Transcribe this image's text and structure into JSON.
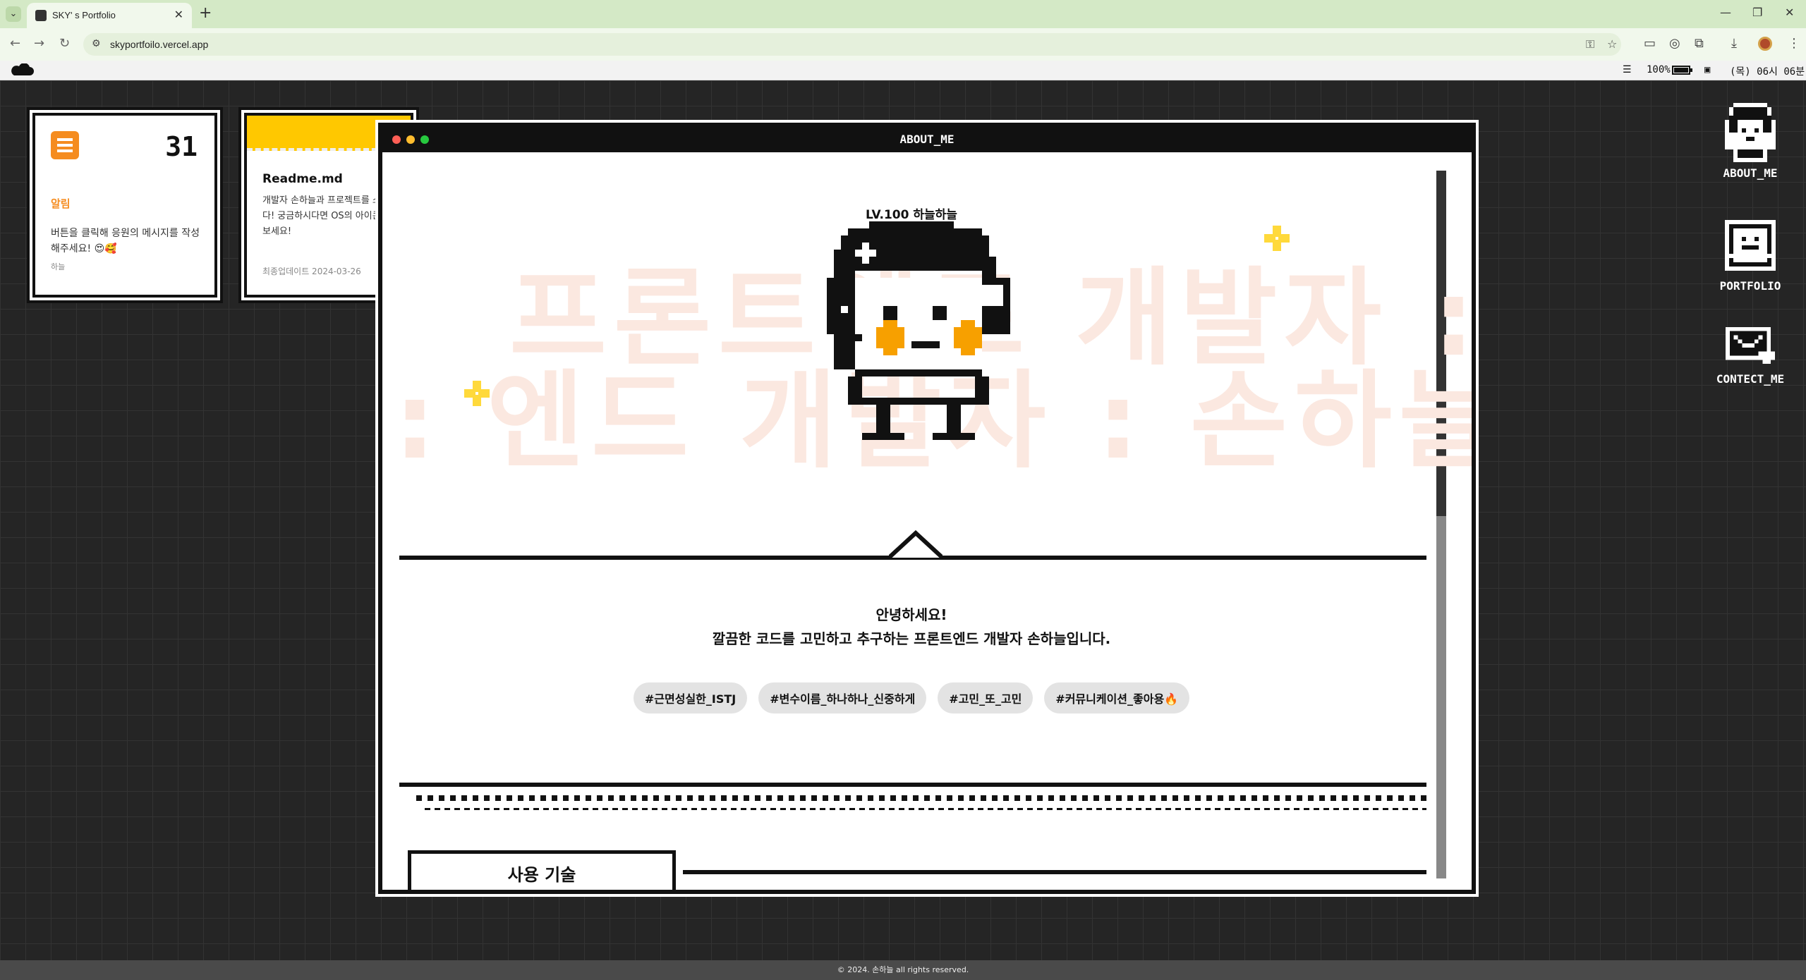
{
  "browser": {
    "tab_title": "SKY' s Portfolio",
    "url": "skyportfoilo.vercel.app"
  },
  "menubar": {
    "battery_percent": "100%",
    "time": "(목) 06시 06분"
  },
  "widgets": {
    "notice": {
      "day": "31",
      "title": "알림",
      "text": "버튼을 클릭해 응원의 메시지를 작성해주세요! 😍🥰",
      "user": "하늘"
    },
    "readme": {
      "title": "Readme.md",
      "text": "개발자 손하늘과 프로젝트를 소개합니다! 궁금하시다면 OS의 아이콘을 클릭해보세요!",
      "updated": "최종업데이트 2024-03-26"
    }
  },
  "window": {
    "title": "ABOUT_ME",
    "level_label": "LV.100 하늘하늘",
    "bg_line1": "프론트엔드 개발자 :",
    "bg_line2": ": 엔드 개발자 : 손하늘",
    "greeting": "안녕하세요!",
    "intro": "깔끔한 코드를 고민하고 추구하는 프론트엔드 개발자 손하늘입니다.",
    "tags": [
      "#근면성실한_ISTJ",
      "#변수이름_하나하나_신중하게",
      "#고민_또_고민",
      "#커뮤니케이션_좋아용🔥"
    ],
    "skills_heading": "사용 기술"
  },
  "desktop_icons": [
    {
      "label": "ABOUT_ME",
      "icon": "avatar-icon"
    },
    {
      "label": "PORTFOLIO",
      "icon": "folder-icon"
    },
    {
      "label": "CONTECT_ME",
      "icon": "mail-heart-icon"
    }
  ],
  "footer": "© 2024. 손하늘 all rights reserved.",
  "colors": {
    "accent_orange": "#f58c1f",
    "readme_yellow": "#ffc800",
    "tab_green": "#d4e9c6"
  }
}
